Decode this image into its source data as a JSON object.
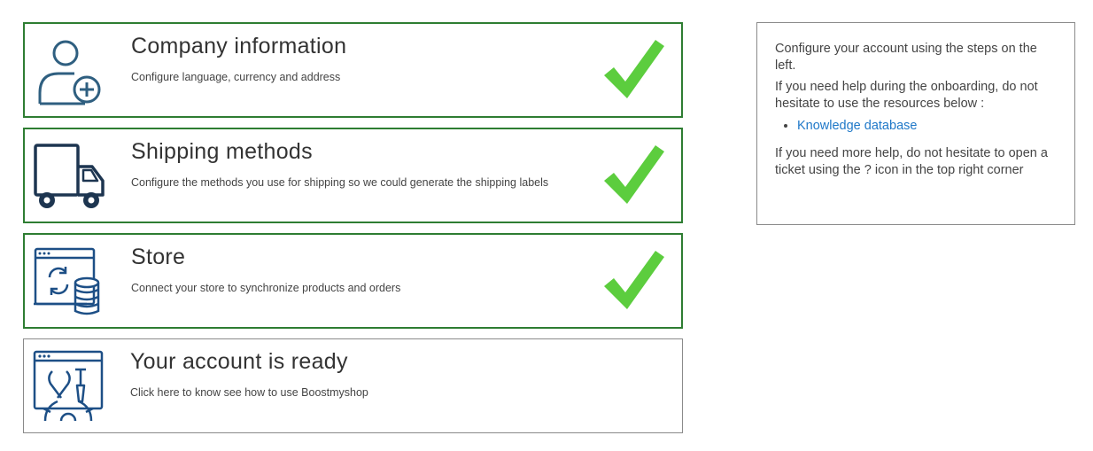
{
  "steps": [
    {
      "title": "Company information",
      "description": "Configure language, currency and address",
      "icon": "user-add-icon",
      "completed": true
    },
    {
      "title": "Shipping methods",
      "description": "Configure the methods you use for shipping so we could generate the shipping labels",
      "icon": "truck-icon",
      "completed": true
    },
    {
      "title": "Store",
      "description": "Connect your store to synchronize products and orders",
      "icon": "store-sync-icon",
      "completed": true
    },
    {
      "title": "Your account is ready",
      "description": "Click here to know see how to use Boostmyshop",
      "icon": "tools-gear-icon",
      "completed": false
    }
  ],
  "help": {
    "intro": "Configure your account using the steps on the left.",
    "resources_text": "If you need help during the onboarding, do not hesitate to use the resources below :",
    "links": [
      {
        "label": "Knowledge database"
      }
    ],
    "more_help": "If you need more help, do not hesitate to open a ticket using the ? icon in the top right corner"
  },
  "colors": {
    "completed_border": "#2e7d32",
    "check": "#5ccd3e",
    "icon": "#1d5a86",
    "link": "#1f78c8"
  }
}
